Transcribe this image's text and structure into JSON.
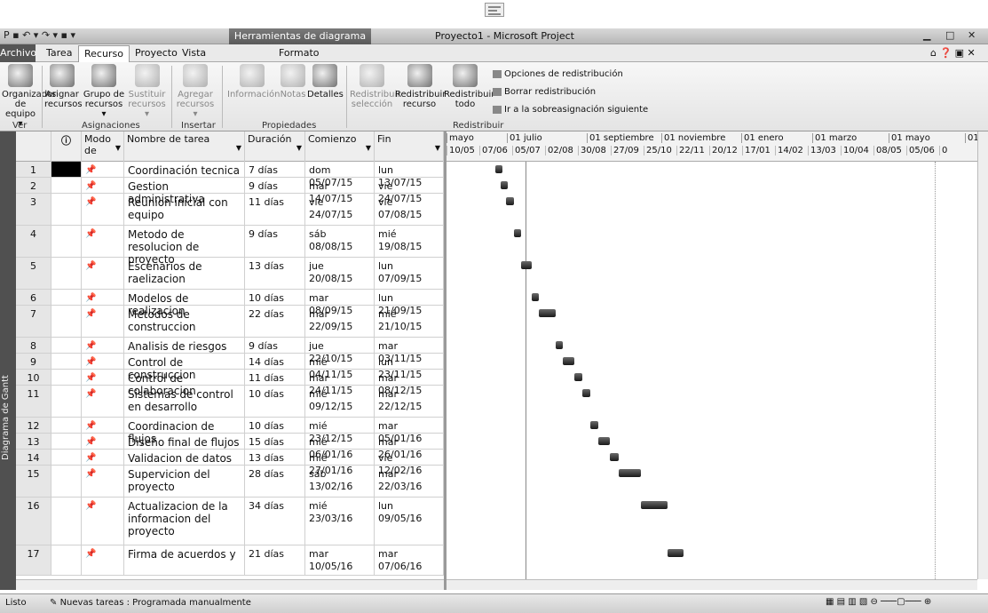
{
  "titlebar": {
    "context_tab": "Herramientas de diagrama de Gantt",
    "window_title": "Proyecto1 - Microsoft Project"
  },
  "menu": {
    "file": "Archivo",
    "tabs": [
      "Tarea",
      "Recurso",
      "Proyecto",
      "Vista"
    ],
    "context": "Formato"
  },
  "ribbon": {
    "organizer": "Organizador de equipo ▾",
    "assign": "Asignar recursos",
    "group": "Grupo de recursos ▾",
    "substitute": "Sustituir recursos ▾",
    "add": "Agregar recursos ▾",
    "info": "Información",
    "notes": "Notas",
    "details": "Detalles",
    "level_sel": "Redistribuir selección",
    "level_res": "Redistribuir recurso",
    "level_all": "Redistribuir todo",
    "opt1": "Opciones de redistribución",
    "opt2": "Borrar redistribución",
    "opt3": "Ir a la sobreasignación siguiente",
    "groups": [
      "Ver",
      "Asignaciones",
      "Insertar",
      "Propiedades",
      "Redistribuir"
    ]
  },
  "side_label": "Diagrama de Gantt",
  "table": {
    "headers": [
      "Modo de",
      "Nombre de tarea",
      "Duración",
      "Comienzo",
      "Fin"
    ],
    "rows": [
      {
        "id": "1",
        "name": "Coordinación tecnica",
        "dur": "7 días",
        "start": "dom 05/07/15",
        "end": "lun 13/07/15"
      },
      {
        "id": "2",
        "name": "Gestion administrativa",
        "dur": "9 días",
        "start": "mar 14/07/15",
        "end": "vie 24/07/15"
      },
      {
        "id": "3",
        "name": "Reunion inicial con equipo",
        "dur": "11 días",
        "start": "vie 24/07/15",
        "end": "vie 07/08/15"
      },
      {
        "id": "4",
        "name": "Metodo de resolucion de proyecto",
        "dur": "9 días",
        "start": "sáb 08/08/15",
        "end": "mié 19/08/15"
      },
      {
        "id": "5",
        "name": "Escenarios de raelizacion",
        "dur": "13 días",
        "start": "jue 20/08/15",
        "end": "lun 07/09/15"
      },
      {
        "id": "6",
        "name": "Modelos de realizacion",
        "dur": "10 días",
        "start": "mar 08/09/15",
        "end": "lun 21/09/15"
      },
      {
        "id": "7",
        "name": "Metodos de construccion",
        "dur": "22 días",
        "start": "mar 22/09/15",
        "end": "mié 21/10/15"
      },
      {
        "id": "8",
        "name": "Analisis de riesgos",
        "dur": "9 días",
        "start": "jue 22/10/15",
        "end": "mar 03/11/15"
      },
      {
        "id": "9",
        "name": "Control de construccion",
        "dur": "14 días",
        "start": "mié 04/11/15",
        "end": "lun 23/11/15"
      },
      {
        "id": "10",
        "name": "Control de colaboracion",
        "dur": "11 días",
        "start": "mar 24/11/15",
        "end": "mar 08/12/15"
      },
      {
        "id": "11",
        "name": "Sistemas de control en desarrollo",
        "dur": "10 días",
        "start": "mié 09/12/15",
        "end": "mar 22/12/15"
      },
      {
        "id": "12",
        "name": "Coordinacion de flujos",
        "dur": "10 días",
        "start": "mié 23/12/15",
        "end": "mar 05/01/16"
      },
      {
        "id": "13",
        "name": "Diseño final de flujos",
        "dur": "15 días",
        "start": "mié 06/01/16",
        "end": "mar 26/01/16"
      },
      {
        "id": "14",
        "name": "Validacion de datos",
        "dur": "13 días",
        "start": "mié 27/01/16",
        "end": "vie 12/02/16"
      },
      {
        "id": "15",
        "name": "Supervicion del proyecto",
        "dur": "28 días",
        "start": "sáb 13/02/16",
        "end": "mar 22/03/16"
      },
      {
        "id": "16",
        "name": "Actualizacion de la informacion del proyecto",
        "dur": "34 días",
        "start": "mié 23/03/16",
        "end": "lun 09/05/16"
      },
      {
        "id": "17",
        "name": "Firma de acuerdos y",
        "dur": "21 días",
        "start": "mar 10/05/16",
        "end": "mar 07/06/16"
      }
    ]
  },
  "timescale": {
    "months": [
      "mayo",
      "01 julio",
      "01 septiembre",
      "01 noviembre",
      "01 enero",
      "01 marzo",
      "01 mayo",
      "01"
    ],
    "weeks": [
      "10/05",
      "07/06",
      "05/07",
      "02/08",
      "30/08",
      "27/09",
      "25/10",
      "22/11",
      "20/12",
      "17/01",
      "14/02",
      "13/03",
      "10/04",
      "08/05",
      "05/06",
      "0"
    ]
  },
  "status": {
    "ready": "Listo",
    "newtasks": "Nuevas tareas : Programada manualmente"
  }
}
